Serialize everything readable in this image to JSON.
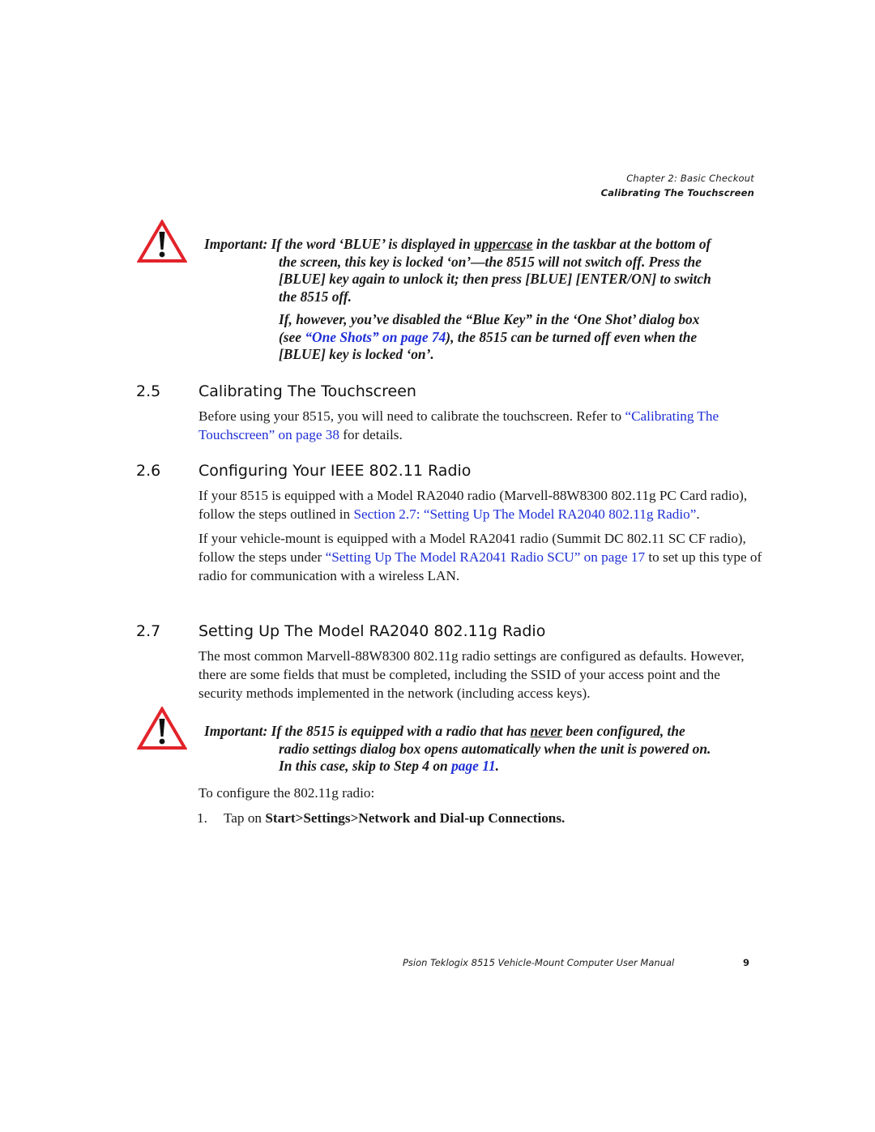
{
  "header": {
    "chapter": "Chapter 2: Basic Checkout",
    "section": "Calibrating The Touchscreen"
  },
  "note1": {
    "icon": "warning-triangle-icon",
    "label": "Important:",
    "line1_pre": "If the word ‘BLUE’ is displayed in ",
    "line1_underlined": "uppercase",
    "line1_post": " in the taskbar at the bottom of",
    "line2": "the screen, this key is locked ‘on’—the 8515 will not switch off. Press the",
    "line3": "[BLUE] key again to unlock it; then press [BLUE] [ENTER/ON] to switch",
    "line4": "the 8515 off.",
    "para2_line1": "If, however, you’ve disabled the “Blue Key” in the ‘One Shot’ dialog box",
    "para2_line2_pre": "(see ",
    "para2_line2_link": "“One Shots” on page 74",
    "para2_line2_post": "), the 8515 can be turned off even when the",
    "para2_line3": "[BLUE] key is locked ‘on’."
  },
  "section_2_5": {
    "number": "2.5",
    "title": "Calibrating The Touchscreen",
    "text_pre": "Before using your 8515, you will need to calibrate the touchscreen. Refer to ",
    "link": "“Calibrating The Touchscreen” on page 38",
    "text_post": " for details."
  },
  "section_2_6": {
    "number": "2.6",
    "title": "Configuring Your IEEE 802.11 Radio",
    "p1_pre": "If your 8515 is equipped with a Model RA2040 radio (Marvell-88W8300 802.11g PC Card radio), follow the steps outlined in ",
    "p1_link": "Section 2.7: “Setting Up The Model RA2040 802.11g Radio”",
    "p1_post": ".",
    "p2_pre": "If your vehicle-mount is equipped with a Model RA2041 radio (Summit DC 802.11 SC CF radio), follow the steps under ",
    "p2_link": "“Setting Up The Model RA2041 Radio SCU” on page 17",
    "p2_post": " to set up this type of radio for communication with a wireless LAN."
  },
  "section_2_7": {
    "number": "2.7",
    "title": "Setting Up The Model RA2040 802.11g Radio",
    "p1": "The most common Marvell-88W8300 802.11g radio settings are configured as defaults. However, there are some fields that must be completed, including the SSID of your access point and the security methods implemented in the network (including access keys)."
  },
  "note2": {
    "icon": "warning-triangle-icon",
    "label": "Important:",
    "line1_pre": "If the 8515 is equipped with a radio that has ",
    "line1_underlined": "never",
    "line1_post": " been configured, the",
    "line2": "radio settings dialog box opens automatically when the unit is powered on.",
    "line3_pre": "In this case, skip to Step 4 on ",
    "line3_link": "page 11",
    "line3_post": "."
  },
  "procedure": {
    "intro": "To configure the 802.11g radio:",
    "steps": [
      {
        "number": "1.",
        "text_pre": "Tap on ",
        "text_bold": "Start>Settings>Network and Dial-up Connections."
      }
    ]
  },
  "footer": {
    "title": "Psion Teklogix 8515 Vehicle-Mount Computer User Manual",
    "page": "9"
  },
  "colors": {
    "link": "#1f2fd6",
    "warning_red": "#e2232a"
  }
}
